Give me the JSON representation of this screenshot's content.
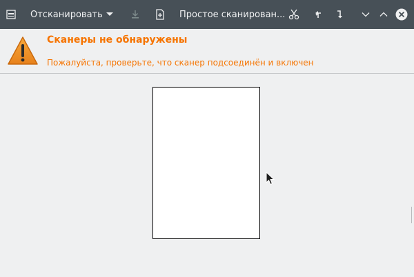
{
  "window": {
    "title": "Простое сканирование"
  },
  "toolbar": {
    "scan_label": "Отсканировать",
    "mode_label": "Простое сканирован...",
    "icons": {
      "app_menu": "scanner-menu-icon",
      "scan_dropdown": "chevron-down-icon",
      "save": "save-download-icon",
      "new_document": "new-document-icon",
      "crop": "scissors-icon",
      "rotate_left": "rotate-left-icon",
      "rotate_right": "rotate-right-icon",
      "minimize": "minimize-icon",
      "maximize": "maximize-icon",
      "close": "close-icon"
    }
  },
  "infobar": {
    "title": "Сканеры не обнаружены",
    "message": "Пожалуйста, проверьте, что сканер подсоединён и включен",
    "icon": "warning-icon"
  },
  "colors": {
    "headerbar": "#475057",
    "warning_text": "#f67400",
    "background": "#eff0f1"
  }
}
